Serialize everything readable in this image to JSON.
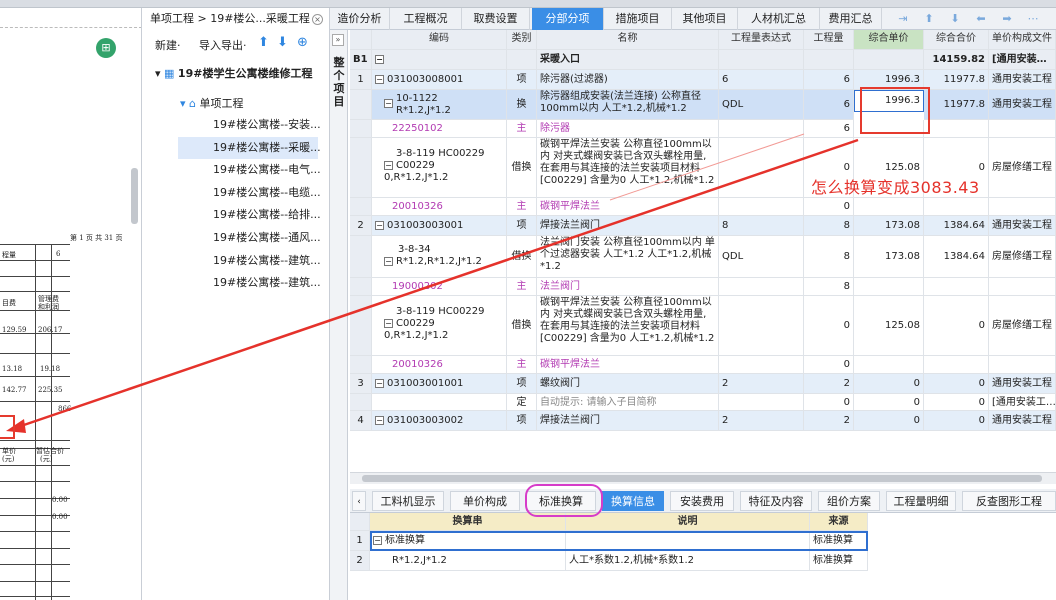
{
  "breadcrumb": "单项工程 > 19#楼公...采暖工程",
  "main_tabs": [
    {
      "label": "造价分析",
      "active": false
    },
    {
      "label": "工程概况",
      "active": false
    },
    {
      "label": "取费设置",
      "active": false
    },
    {
      "label": "分部分项",
      "active": true
    },
    {
      "label": "措施项目",
      "active": false
    },
    {
      "label": "其他项目",
      "active": false
    },
    {
      "label": "人材机汇总",
      "active": false
    },
    {
      "label": "费用汇总",
      "active": false
    }
  ],
  "tree_toolbar": {
    "new_label": "新建·",
    "import_export_label": "导入导出·"
  },
  "tree": {
    "project": "19#楼学生公寓楼维修工程",
    "unit": "单项工程",
    "items": [
      "19#楼公寓楼--安装...",
      "19#楼公寓楼--采暖...",
      "19#楼公寓楼--电气...",
      "19#楼公寓楼--电缆...",
      "19#楼公寓楼--给排...",
      "19#楼公寓楼--通风...",
      "19#楼公寓楼--建筑...",
      "19#楼公寓楼--建筑..."
    ],
    "selected_index": 1
  },
  "collapse_label": "整个项目",
  "doc_preview": {
    "page_info": "第 1 页  共 31 页",
    "labels": [
      "程量",
      "6",
      "目费",
      "管理费",
      "和利润"
    ],
    "values": [
      "129.59",
      "206.17",
      "13.18",
      "19.18",
      "142.77",
      "225.35"
    ],
    "footer_labels": [
      "单价",
      "(元)",
      "暂估合价",
      "(元)"
    ],
    "zeros": [
      "0.00",
      "0.00"
    ],
    "note": "866"
  },
  "grid": {
    "headers": [
      "",
      "编码",
      "类别",
      "名称",
      "工程量表达式",
      "工程量",
      "综合单价",
      "综合合价",
      "单价构成文件"
    ],
    "active_header": 6,
    "section": {
      "index": "B1",
      "name": "采暖入口",
      "total": "14159.82",
      "file": "[通用安装…"
    },
    "rows": [
      {
        "idx": "1",
        "code": "031003008001",
        "tog": "−",
        "type": "项",
        "name": "除污器(过滤器)",
        "expr": "6",
        "qty": "6",
        "price": "1996.3",
        "total": "11977.8",
        "file": "通用安装工程",
        "style": "blue"
      },
      {
        "idx": "",
        "code": "10-1122",
        "code2": "R*1.2,J*1.2",
        "tog": "−",
        "type": "换",
        "name": "除污器组成安装(法兰连接) 公称直径100mm以内  人工*1.2,机械*1.2",
        "expr": "QDL",
        "qty": "6",
        "price": "1996.3",
        "total": "11977.8",
        "file": "通用安装工程",
        "style": "sel"
      },
      {
        "idx": "",
        "code": "22250102",
        "tog": "",
        "type": "主",
        "name": "除污器",
        "expr": "",
        "qty": "6",
        "price": "",
        "total": "",
        "file": "",
        "style": "purple"
      },
      {
        "idx": "",
        "code": "3-8-119 HC00229",
        "code2": "C00229",
        "code3": "0,R*1.2,J*1.2",
        "tog": "−",
        "type": "借换",
        "name": "碳钢平焊法兰安装 公称直径100mm以内  对夹式蝶阀安装已含双头螺栓用量,在套用与其连接的法兰安装项目材料[C00229] 含量为0  人工*1.2,机械*1.2",
        "expr": "",
        "qty": "0",
        "price": "125.08",
        "total": "0",
        "file": "房屋修缮工程",
        "style": "tall"
      },
      {
        "idx": "",
        "code": "20010326",
        "tog": "",
        "type": "主",
        "name": "碳钢平焊法兰",
        "expr": "",
        "qty": "0",
        "price": "",
        "total": "",
        "file": "",
        "style": "purple"
      },
      {
        "idx": "2",
        "code": "031003003001",
        "tog": "−",
        "type": "项",
        "name": "焊接法兰阀门",
        "expr": "8",
        "qty": "8",
        "price": "173.08",
        "total": "1384.64",
        "file": "通用安装工程",
        "style": "blue"
      },
      {
        "idx": "",
        "code": "3-8-34",
        "code2": "R*1.2,R*1.2,J*1.2",
        "tog": "−",
        "type": "借换",
        "name": "法兰阀门安装 公称直径100mm以内  单个过滤器安装 人工*1.2  人工*1.2,机械*1.2",
        "expr": "QDL",
        "qty": "8",
        "price": "173.08",
        "total": "1384.64",
        "file": "房屋修缮工程",
        "style": "mid"
      },
      {
        "idx": "",
        "code": "19000202",
        "tog": "",
        "type": "主",
        "name": "法兰阀门",
        "expr": "",
        "qty": "8",
        "price": "",
        "total": "",
        "file": "",
        "style": "purple"
      },
      {
        "idx": "",
        "code": "3-8-119 HC00229",
        "code2": "C00229",
        "code3": "0,R*1.2,J*1.2",
        "tog": "−",
        "type": "借换",
        "name": "碳钢平焊法兰安装 公称直径100mm以内  对夹式蝶阀安装已含双头螺栓用量,在套用与其连接的法兰安装项目材料[C00229] 含量为0  人工*1.2,机械*1.2",
        "expr": "",
        "qty": "0",
        "price": "125.08",
        "total": "0",
        "file": "房屋修缮工程",
        "style": "tall"
      },
      {
        "idx": "",
        "code": "20010326",
        "tog": "",
        "type": "主",
        "name": "碳钢平焊法兰",
        "expr": "",
        "qty": "0",
        "price": "",
        "total": "",
        "file": "",
        "style": "purple"
      },
      {
        "idx": "3",
        "code": "031003001001",
        "tog": "−",
        "type": "项",
        "name": "螺纹阀门",
        "expr": "2",
        "qty": "2",
        "price": "0",
        "total": "0",
        "file": "通用安装工程",
        "style": "blue"
      },
      {
        "idx": "",
        "code": "",
        "tog": "",
        "type": "定",
        "name": "自动提示: 请输入子目简称",
        "expr": "",
        "qty": "0",
        "price": "0",
        "total": "0",
        "file": "[通用安装工…",
        "style": "hint"
      },
      {
        "idx": "4",
        "code": "031003003002",
        "tog": "−",
        "type": "项",
        "name": "焊接法兰阀门",
        "expr": "2",
        "qty": "2",
        "price": "0",
        "total": "0",
        "file": "通用安装工程",
        "style": "blue"
      }
    ]
  },
  "bottom_tabs": [
    {
      "label": "工料机显示",
      "active": false
    },
    {
      "label": "单价构成",
      "active": false
    },
    {
      "label": "标准换算",
      "active": false
    },
    {
      "label": "换算信息",
      "active": true
    },
    {
      "label": "安装费用",
      "active": false
    },
    {
      "label": "特征及内容",
      "active": false
    },
    {
      "label": "组价方案",
      "active": false
    },
    {
      "label": "工程量明细",
      "active": false
    },
    {
      "label": "反查图形工程",
      "active": false
    }
  ],
  "bottom_grid": {
    "headers": [
      "换算串",
      "说明",
      "来源"
    ],
    "rows": [
      {
        "idx": "1",
        "expr": "标准换算",
        "desc": "",
        "src": "标准换算"
      },
      {
        "idx": "2",
        "expr": "R*1.2,J*1.2",
        "desc": "人工*系数1.2,机械*系数1.2",
        "src": "标准换算"
      }
    ]
  },
  "annotation": {
    "question": "怎么换算变成3083.43",
    "color": "#e5322b"
  }
}
